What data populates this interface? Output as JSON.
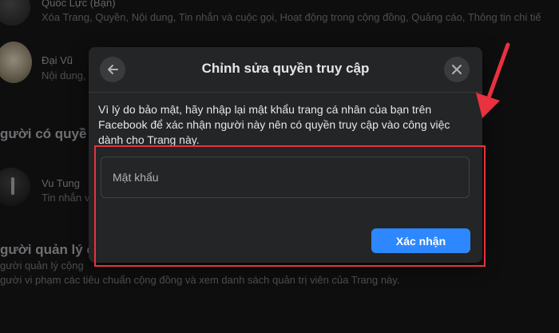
{
  "background": {
    "row1": {
      "name": "Quốc Lực (Bạn)",
      "desc": "Xóa Trang, Quyền, Nội dung, Tin nhắn và cuộc gọi, Hoạt động trong cộng đồng, Quảng cáo, Thông tin chi tiế"
    },
    "row2": {
      "name": "Đại Vũ",
      "desc": "Nội dung, T"
    },
    "section1_heading": "gười có quyề",
    "row3": {
      "name": "Vu Tung",
      "desc": "Tin nhắn v"
    },
    "section2_heading": "gười quản lý cộn",
    "section2_line1": "gười quản lý cộng",
    "section2_line2": "gười vi phạm các tiêu chuẩn cộng đồng và xem danh sách quản trị viên của Trang này."
  },
  "modal": {
    "title": "Chỉnh sửa quyền truy cập",
    "description": "Vì lý do bảo mật, hãy nhập lại mật khẩu trang cá nhân của bạn trên Facebook để xác nhận người này nên có quyền truy cập vào công việc dành cho Trang này.",
    "password_placeholder": "Mật khẩu",
    "confirm_label": "Xác nhận"
  },
  "icons": {
    "back": "arrow-left-icon",
    "close": "close-icon",
    "annotation": "red-arrow-icon"
  },
  "colors": {
    "page_bg": "#141415",
    "modal_bg": "#242526",
    "primary": "#2d88ff",
    "annotation": "#e8323e"
  }
}
